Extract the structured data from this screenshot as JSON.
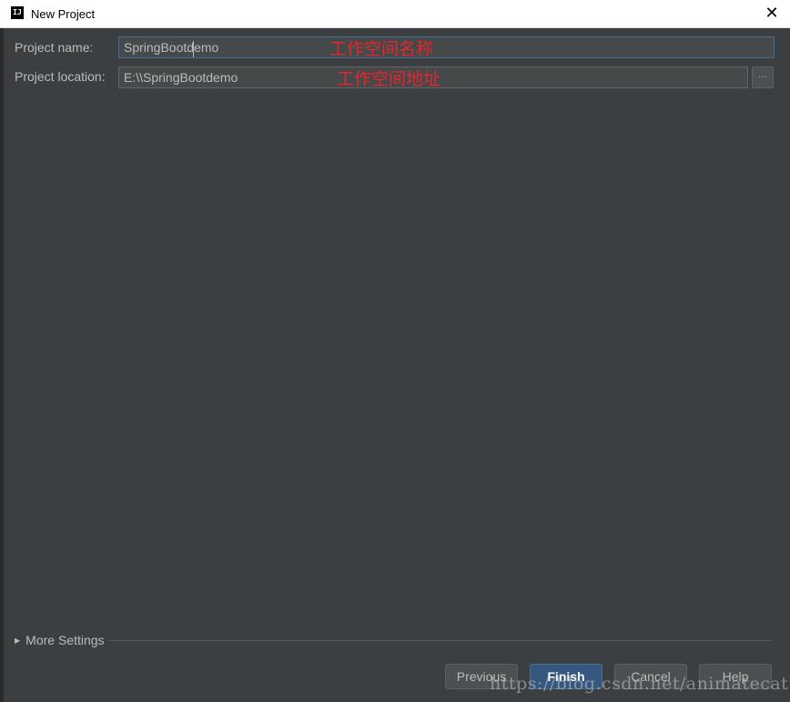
{
  "window": {
    "title": "New Project",
    "icon_text": "IJ"
  },
  "form": {
    "name_label": "Project name:",
    "name_value": "SpringBootdemo",
    "name_annotation": "工作空间名称",
    "location_label": "Project location:",
    "location_value": "E:\\\\SpringBootdemo",
    "location_annotation": "工作空间地址",
    "browse_label": "..."
  },
  "more_settings": {
    "label": "More Settings"
  },
  "buttons": {
    "previous": "Previous",
    "finish": "Finish",
    "cancel": "Cancel",
    "help": "Help"
  },
  "watermark": "https://blog.csdn.net/animatecat",
  "colors": {
    "background": "#3c3f41",
    "annotation": "#e8242d",
    "primary_button": "#365880"
  }
}
